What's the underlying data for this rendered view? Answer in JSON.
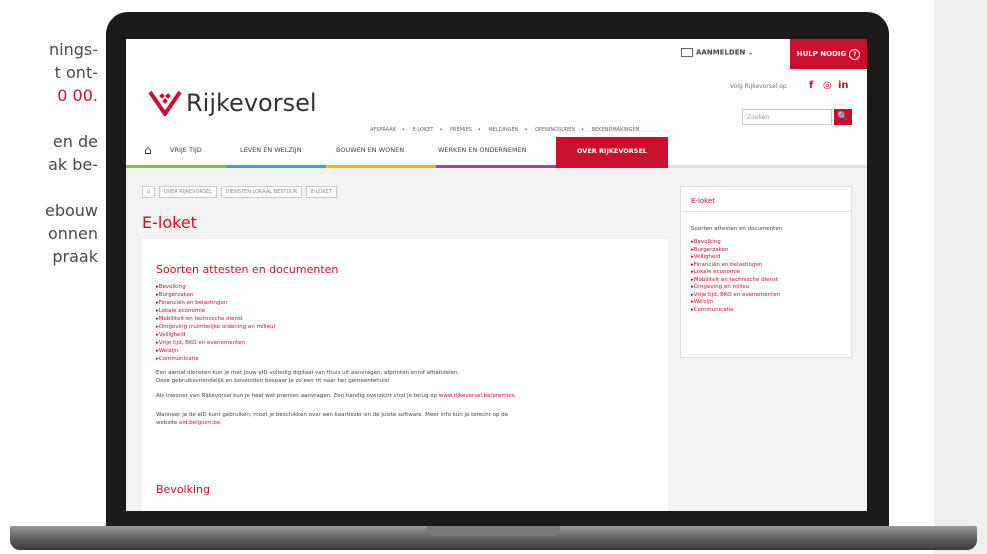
{
  "left_text": {
    "p1": [
      "nings-",
      "t ont-",
      "0 00."
    ],
    "p2": [
      "en de",
      "ak be-"
    ],
    "p3": [
      "ebouw",
      "onnen",
      "praak"
    ]
  },
  "site": {
    "topbar": {
      "aanmelden": "AANMELDEN",
      "hulp": "HULP NODIG",
      "hulp_icon": "?"
    },
    "header": {
      "logo_text": "Rijkevorsel",
      "volg_text": "Volg Rijkevorsel op",
      "social_icons": [
        "f",
        "◎",
        "in"
      ],
      "quicklinks": [
        "AFSPRAAK",
        "E-LOKET",
        "PREMIES",
        "MELDINGEN",
        "OPENINGSUREN",
        "BEKENDMAKINGEN"
      ],
      "search_placeholder": "Zoeken",
      "search_icon": "🔍"
    },
    "nav": {
      "home_icon": "⌂",
      "items": [
        "VRIJE TIJD",
        "LEVEN EN WELZIJN",
        "BOUWEN EN WONEN",
        "WERKEN EN ONDERNEMEN"
      ],
      "active": "OVER RIJKEVORSEL",
      "colors": [
        "#8dbf3f",
        "#3aa3d8",
        "#f2b705",
        "#8e4fa3",
        "#c8102e"
      ]
    },
    "breadcrumb": [
      "OVER RIJKEVORSEL",
      "DIENSTEN LOKAAL BESTUUR",
      "E-LOKET"
    ],
    "page_title": "E-loket",
    "main": {
      "section_title": "Soorten attesten en documenten",
      "list": [
        "Bevolking",
        "Burgerzaken",
        "Financiën en belastingen",
        "Lokale economie",
        "Mobiliteit en technische dienst",
        "Omgeving (ruimtelijke ordening en milieu)",
        "Veiligheid",
        "Vrije tijd, BKO en evenementen",
        "Welzijn",
        "Communicatie"
      ],
      "para1a": "Een aantal diensten kun je met Jouw eID volledig digitaal van thuis uit aanvragen, afprinten en/of afhandelen.",
      "para1b": "Deze gebruiksvriendelijk en bovendien bespaar je zo een rit naar het gemeentehuis!",
      "para2": "Als inwoner van Rijkevorsel kun je heel wat premies aanvragen. Een handig overzicht vind je terug op",
      "para2_link": "www.rijkevorsel.be/premies.",
      "para3a": "Wanneer je de eID kunt gebruiken, moet je beschikken over een kaartlezer en de juiste software. Meer info kun je terecht op de",
      "para3b": "website",
      "para3_link": "eid.belgium.be.",
      "sub_title": "Bevolking"
    },
    "sidebar": {
      "title": "E-loket",
      "subtitle": "Soorten attesten en documenten",
      "list": [
        "Bevolking",
        "Burgerzaken",
        "Veiligheid",
        "Financiën en belastingen",
        "Lokale economie",
        "Mobiliteit en technische dienst",
        "Omgeving en milieu",
        "Vrije tijd, BKO en evenementen",
        "Welzijn",
        "Communicatie"
      ]
    }
  }
}
